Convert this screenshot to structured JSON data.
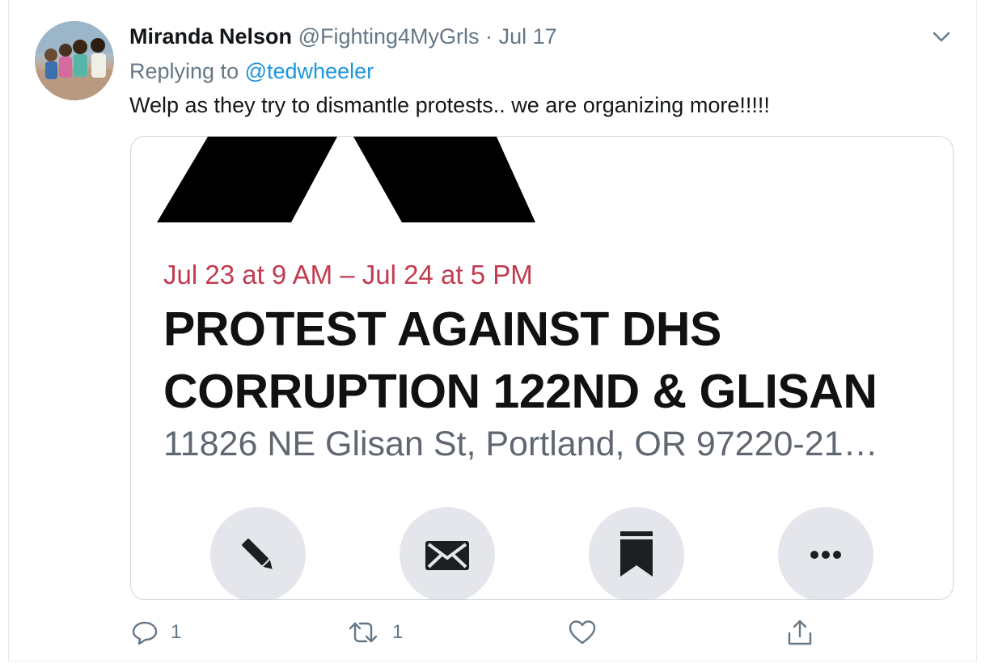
{
  "tweet": {
    "display_name": "Miranda Nelson",
    "handle": "@Fighting4MyGrls",
    "separator": "·",
    "date": "Jul 17",
    "replying_prefix": "Replying to",
    "replying_to": "@tedwheeler",
    "text": "Welp as they try to dismantle protests.. we are organizing more!!!!!"
  },
  "card": {
    "event_date": "Jul 23 at 9 AM – Jul 24 at 5 PM",
    "title_line1": "PROTEST AGAINST DHS",
    "title_line2": "CORRUPTION 122ND & GLISAN",
    "address": "11826 NE Glisan St, Portland, OR 97220-21…",
    "buttons": [
      "pencil-icon",
      "envelope-icon",
      "bookmark-icon",
      "more-icon"
    ]
  },
  "actions": {
    "reply_count": "1",
    "retweet_count": "1",
    "like_count": "",
    "share_count": ""
  },
  "colors": {
    "link": "#1b95e0",
    "muted": "#657786",
    "event_date": "#c23b4f",
    "button_bg": "#e4e6eb"
  }
}
